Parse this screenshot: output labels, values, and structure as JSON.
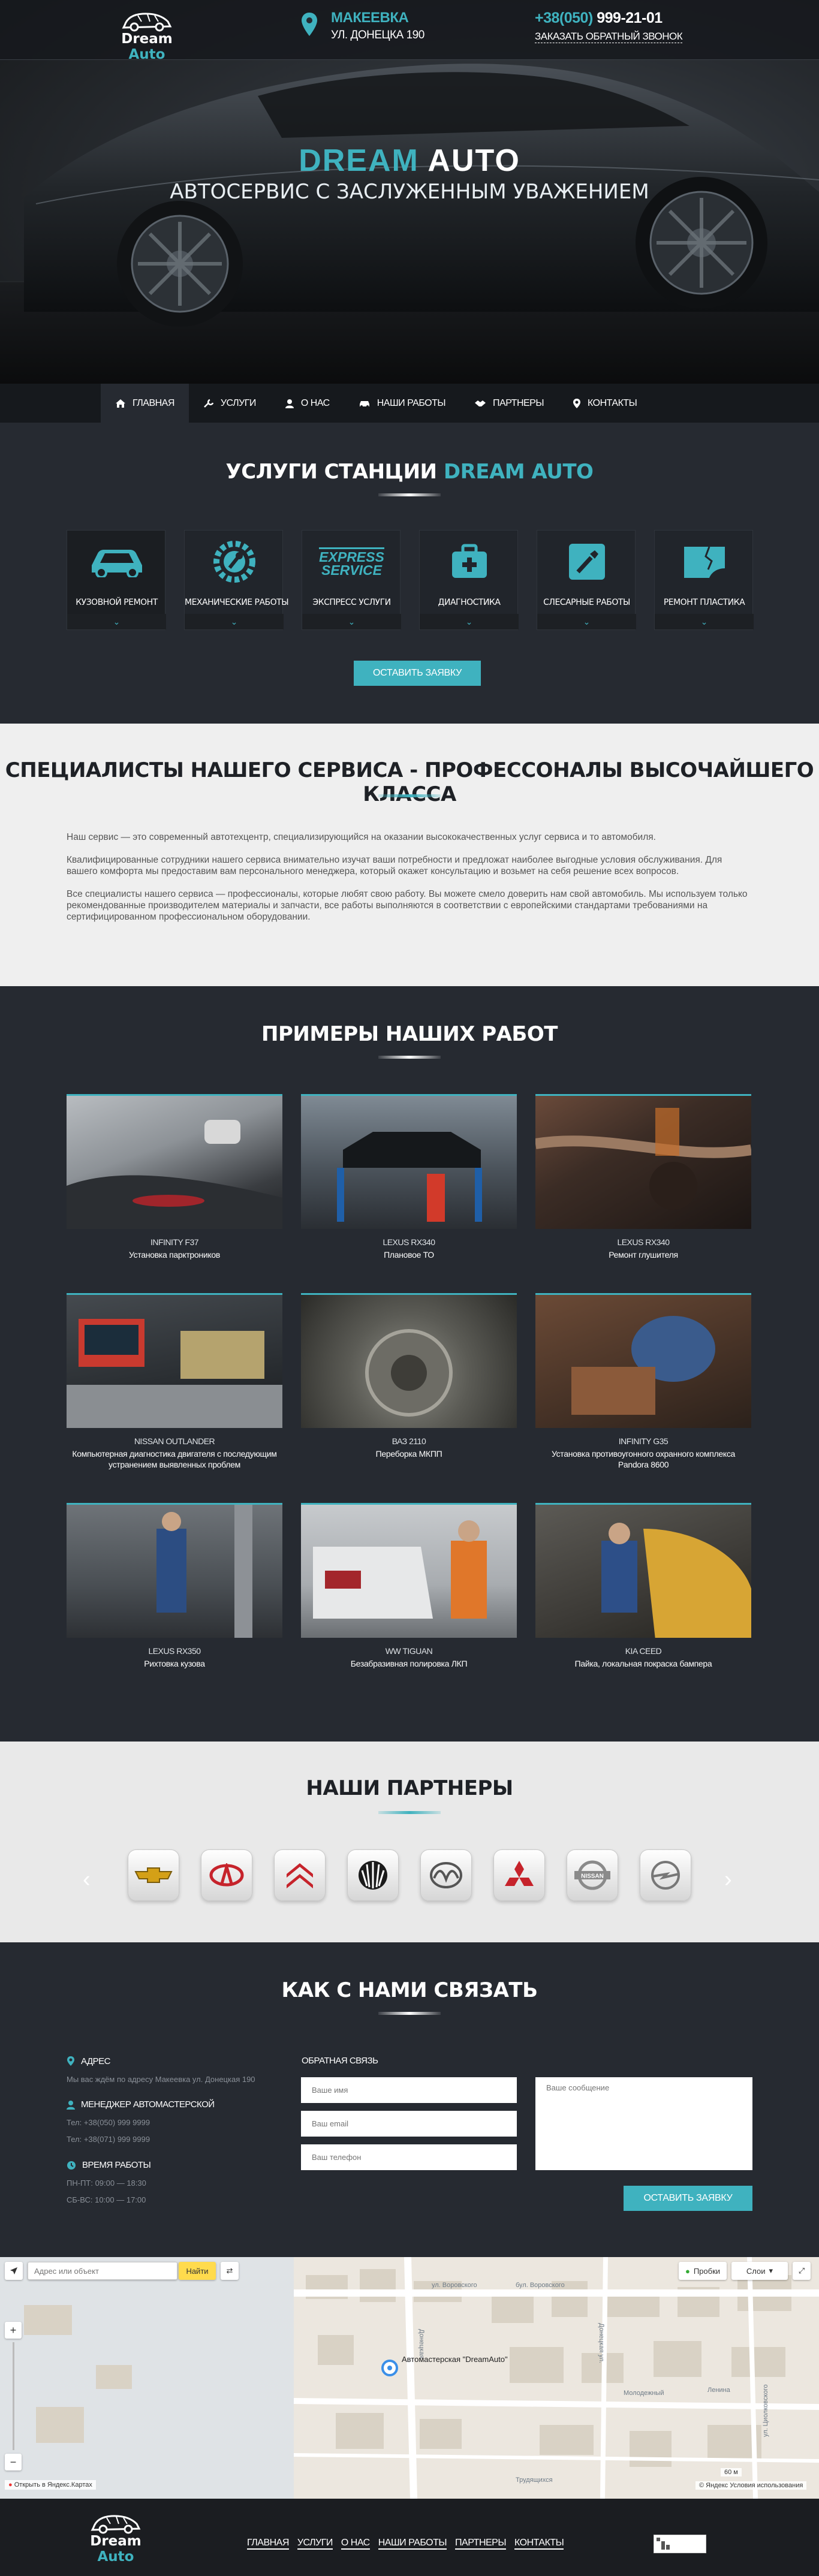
{
  "header": {
    "logo": {
      "word1": "Dream",
      "word2": "Auto"
    },
    "address": {
      "city": "МАКЕЕВКА",
      "street": "УЛ. ДОНЕЦКА 190"
    },
    "phone": {
      "prefix": "+38(050)",
      "number": "999-21-01"
    },
    "callback_label": "ЗАКАЗАТЬ ОБРАТНЫЙ ЗВОНОК"
  },
  "hero": {
    "title_part1": "DREAM",
    "title_part2": "AUTO",
    "subtitle": "АВТОСЕРВИС С ЗАСЛУЖЕННЫМ УВАЖЕНИЕМ"
  },
  "nav": [
    {
      "label": "ГЛАВНАЯ",
      "icon": "home-icon",
      "active": true
    },
    {
      "label": "УСЛУГИ",
      "icon": "wrench-icon"
    },
    {
      "label": "О НАС",
      "icon": "user-icon"
    },
    {
      "label": "НАШИ РАБОТЫ",
      "icon": "car-icon"
    },
    {
      "label": "ПАРТНЕРЫ",
      "icon": "handshake-icon"
    },
    {
      "label": "КОНТАКТЫ",
      "icon": "pin-icon"
    }
  ],
  "services": {
    "title_part1": "УСЛУГИ СТАНЦИИ",
    "title_part2": "DREAM AUTO",
    "items": [
      {
        "label": "КУЗОВНОЙ РЕМОНТ",
        "icon": "car-body-icon"
      },
      {
        "label": "МЕХАНИЧЕСКИЕ РАБОТЫ",
        "icon": "gear-wrench-icon"
      },
      {
        "label": "ЭКСПРЕСС УСЛУГИ",
        "icon": "express-service-icon",
        "icon_text1": "EXPRESS",
        "icon_text2": "SERVICE"
      },
      {
        "label": "ДИАГНОСТИКА",
        "icon": "diagnostic-case-icon"
      },
      {
        "label": "СЛЕСАРНЫЕ РАБОТЫ",
        "icon": "screwdriver-icon"
      },
      {
        "label": "РЕМОНТ ПЛАСТИКА",
        "icon": "plastic-crack-icon"
      }
    ],
    "cta_label": "ОСТАВИТЬ ЗАЯВКУ"
  },
  "specialists": {
    "title": "СПЕЦИАЛИСТЫ НАШЕГО СЕРВИСА - ПРОФЕССОНАЛЫ ВЫСОЧАЙШЕГО КЛАССА",
    "paragraphs": [
      "Наш сервис — это современный автотехцентр, специализирующийся на оказании высококачественных услуг сервиса и то автомобиля.",
      "Квалифицированные сотрудники нашего сервиса внимательно изучат ваши потребности и предложат наиболее выгодные условия обслуживания. Для вашего комфорта мы предоставим вам персонального менеджера, который окажет консультацию и возьмет на себя решение всех вопросов.",
      "Все специалисты нашего сервиса — профессионалы, которые любят свою работу. Вы можете смело доверить нам свой автомобиль. Мы используем только рекомендованные производителем материалы и запчасти, все работы выполняются в соответствии с европейскими стандартами требованиями на сертифицированном профессиональном оборудовании."
    ]
  },
  "works": {
    "title": "ПРИМЕРЫ НАШИХ РАБОТ",
    "items": [
      {
        "model": "INFINITY F37",
        "desc": "Установка парктроников"
      },
      {
        "model": "LEXUS RX340",
        "desc": "Плановое ТО"
      },
      {
        "model": "LEXUS RX340",
        "desc": "Ремонт глушителя"
      },
      {
        "model": "NISSAN OUTLANDER",
        "desc": "Компьютерная диагностика двигателя с последующим устранением выявленных проблем"
      },
      {
        "model": "ВАЗ 2110",
        "desc": "Переборка МКПП"
      },
      {
        "model": "INFINITY G35",
        "desc": "Установка противоугонного охранного комплекса Pandora 8600"
      },
      {
        "model": "LEXUS RX350",
        "desc": "Рихтовка кузова"
      },
      {
        "model": "WW TIGUAN",
        "desc": "Безабразивная полировка ЛКП"
      },
      {
        "model": "KIA CEED",
        "desc": "Пайка, локальная покраска бампера"
      }
    ]
  },
  "partners": {
    "title": "НАШИ ПАРТНЕРЫ",
    "items": [
      {
        "brand": "Chevrolet",
        "icon": "chevrolet-logo-icon"
      },
      {
        "brand": "Chery",
        "icon": "chery-logo-icon"
      },
      {
        "brand": "Citroen",
        "icon": "citroen-logo-icon"
      },
      {
        "brand": "Daewoo",
        "icon": "daewoo-logo-icon"
      },
      {
        "brand": "Mazda",
        "icon": "mazda-logo-icon"
      },
      {
        "brand": "Mitsubishi",
        "icon": "mitsubishi-logo-icon"
      },
      {
        "brand": "Nissan",
        "icon": "nissan-logo-icon"
      },
      {
        "brand": "Opel",
        "icon": "opel-logo-icon"
      }
    ],
    "brand_nissan_text": "NISSAN"
  },
  "contacts": {
    "title": "КАК С НАМИ СВЯЗАТЬ",
    "address_head": "АДРЕС",
    "address_text": "Мы вас ждём по адресу Макеевка ул. Донецкая 190",
    "manager_head": "МЕНЕДЖЕР АВТОМАСТЕРСКОЙ",
    "phone1": "Тел: +38(050) 999 9999",
    "phone2": "Тел: +38(071) 999 9999",
    "hours_head": "ВРЕМЯ РАБОТЫ",
    "hours1": "ПН-ПТ: 09:00 — 18:30",
    "hours2": "СБ-ВС: 10:00 — 17:00",
    "feedback_label": "ОБРАТНАЯ СВЯЗЬ",
    "name_placeholder": "Ваше имя",
    "email_placeholder": "Ваш email",
    "phone_placeholder": "Ваш телефон",
    "message_placeholder": "Ваше сообщение",
    "submit_label": "ОСТАВИТЬ ЗАЯВКУ"
  },
  "map": {
    "search_placeholder": "Адрес или объект",
    "find_label": "Найти",
    "traffic_label": "Пробки",
    "layers_label": "Слои",
    "marker_label": "Автомастерская \"DreamAuto\"",
    "street1": "ул. Воровского",
    "street2": "бул. Воровского",
    "street3": "Донецкая",
    "street4": "ул. Циолковского",
    "street5": "Молодежный",
    "street6": "Трудящихся",
    "street7": "Ленина",
    "street8": "Донецкая ул.",
    "open_label": "Открыть в Яндекс.Картах",
    "copyright": "© Яндекс  Условия использования",
    "scale": "60 м"
  },
  "footer": {
    "nav": [
      "ГЛАВНАЯ",
      "УСЛУГИ",
      "О НАС",
      "НАШИ РАБОТЫ",
      "ПАРТНЕРЫ",
      "КОНТАКТЫ"
    ]
  },
  "colors": {
    "accent": "#3fb2bf",
    "dark": "#262a31",
    "darker": "#16191d",
    "light": "#efefef"
  }
}
